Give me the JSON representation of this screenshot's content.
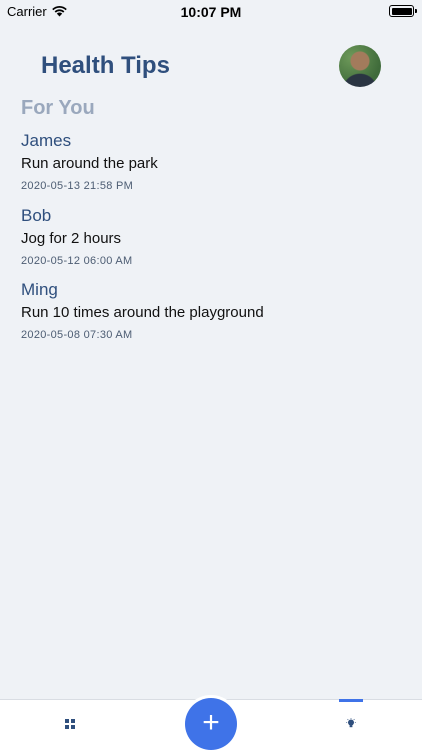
{
  "status_bar": {
    "carrier": "Carrier",
    "time": "10:07 PM"
  },
  "header": {
    "title": "Health Tips",
    "avatar_icon": "user-avatar-photo"
  },
  "section": {
    "title": "For You"
  },
  "tips": [
    {
      "author": "James",
      "text": "Run around the park",
      "date": "2020-05-13 21:58 PM"
    },
    {
      "author": "Bob",
      "text": "Jog for 2 hours",
      "date": "2020-05-12 06:00 AM"
    },
    {
      "author": "Ming",
      "text": "Run 10 times around the playground",
      "date": "2020-05-08 07:30 AM"
    }
  ],
  "bottom_nav": {
    "left_icon": "grid-icon",
    "center_button": "+",
    "right_icon": "lightbulb-icon",
    "active": "tips"
  },
  "colors": {
    "accent": "#3f73e8",
    "title": "#2f4f7d",
    "background": "#eff2f6"
  }
}
